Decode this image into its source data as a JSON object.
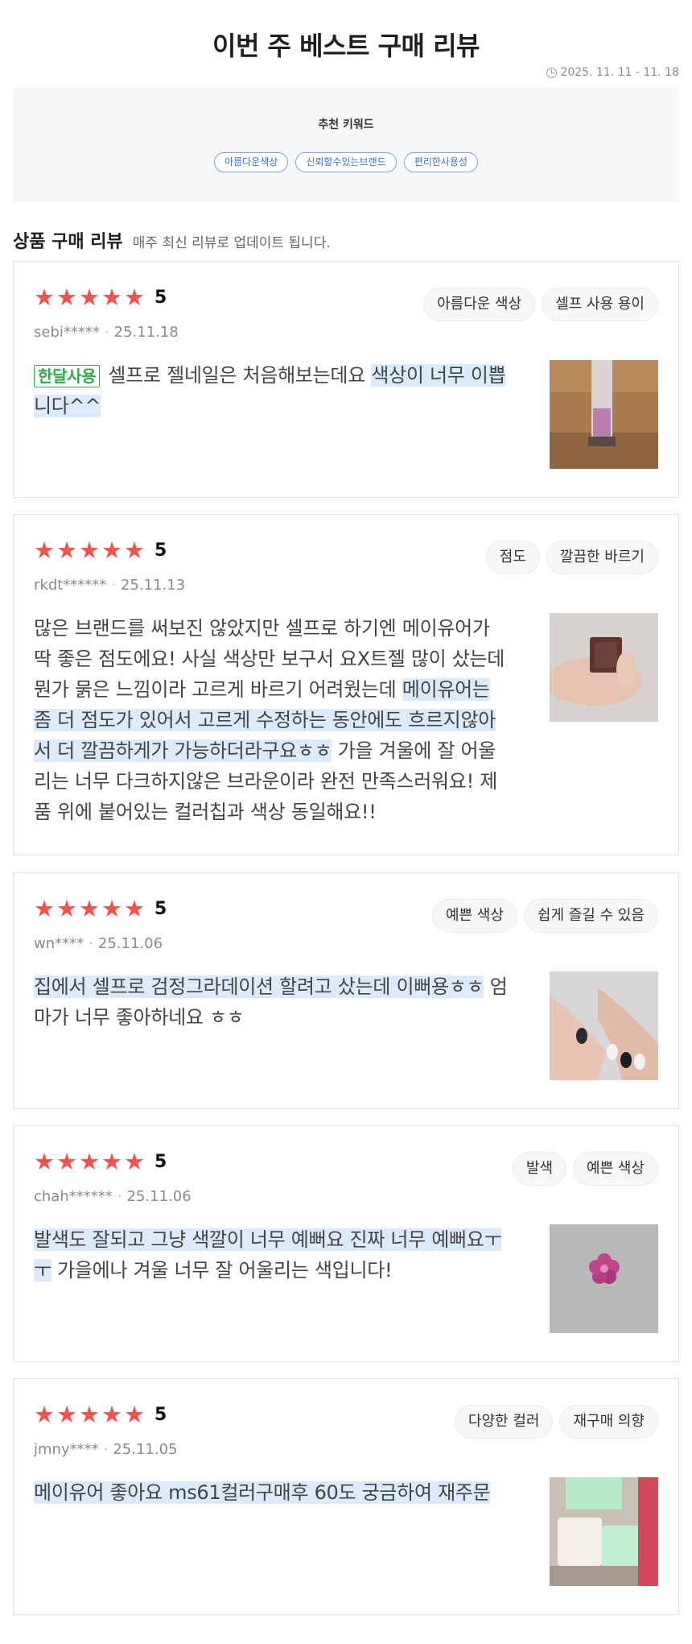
{
  "header": {
    "title": "이번 주 베스트 구매 리뷰",
    "date_range": "2025. 11. 11 - 11. 18"
  },
  "keywords": {
    "title": "추천 키워드",
    "items": [
      "아름다운색상",
      "신뢰할수있는브랜드",
      "편리한사용성"
    ]
  },
  "section": {
    "title": "상품 구매 리뷰",
    "subtitle": "매주 최신 리뷰로 업데이트 됩니다."
  },
  "reviews": [
    {
      "rating": "5",
      "user": "sebi*****",
      "date": "25.11.18",
      "tags": [
        "아름다운 색상",
        "셀프 사용 용이"
      ],
      "badge": "한달사용",
      "text_plain": "셀프로 젤네일은 처음해보는데요 ",
      "text_highlight": "색상이 너무 이쁩니다^^",
      "text_after": "",
      "photo": "lip-gloss-photo"
    },
    {
      "rating": "5",
      "user": "rkdt******",
      "date": "25.11.13",
      "tags": [
        "점도",
        "깔끔한 바르기"
      ],
      "badge": "",
      "text_plain": "많은 브랜드를 써보진 않았지만 셀프로 하기엔 메이유어가 딱 좋은 점도에요! 사실 색상만 보구서 요X트젤 많이 샀는데 뭔가 묽은 느낌이라 고르게 바르기 어려웠는데 ",
      "text_highlight": "메이유어는 좀 더 점도가 있어서 고르게 수정하는 동안에도 흐르지않아서 더 깔끔하게가 가능하더라구요ㅎㅎ",
      "text_after": " 가을 겨울에 잘 어울리는 너무 다크하지않은 브라운이라 완전 만족스러워요! 제품 위에 붙어있는 컬러칩과 색상 동일해요!!",
      "photo": "brown-gel-photo"
    },
    {
      "rating": "5",
      "user": "wn****",
      "date": "25.11.06",
      "tags": [
        "예쁜 색상",
        "쉽게 즐길 수 있음"
      ],
      "badge": "",
      "text_plain": "",
      "text_highlight": "집에서 셀프로 검정그라데이션 할려고 샀는데 이뻐용ㅎㅎ",
      "text_after": " 엄마가 너무 좋아하네요 ㅎㅎ",
      "photo": "nails-photo"
    },
    {
      "rating": "5",
      "user": "chah******",
      "date": "25.11.06",
      "tags": [
        "발색",
        "예쁜 색상"
      ],
      "badge": "",
      "text_plain": "",
      "text_highlight": "발색도 잘되고 그냥 색깔이 너무 예뻐요 진짜 너무 예뻐요ㅜㅜ",
      "text_after": " 가을에나 겨울 너무 잘 어울리는 색입니다!",
      "photo": "flower-charm-photo"
    },
    {
      "rating": "5",
      "user": "jmny****",
      "date": "25.11.05",
      "tags": [
        "다양한 컬러",
        "재구매 의향"
      ],
      "badge": "",
      "text_plain": "",
      "text_highlight": "메이유어 좋아요 ms61컬러구매후 60도 궁금하여 재주문",
      "text_after": "",
      "photo": "mint-bottles-photo"
    }
  ],
  "colors": {
    "star": "#ef5350",
    "highlight": "#dcebfb",
    "keyword_chip": "#3f6fd1",
    "badge": "#2fa84f"
  }
}
